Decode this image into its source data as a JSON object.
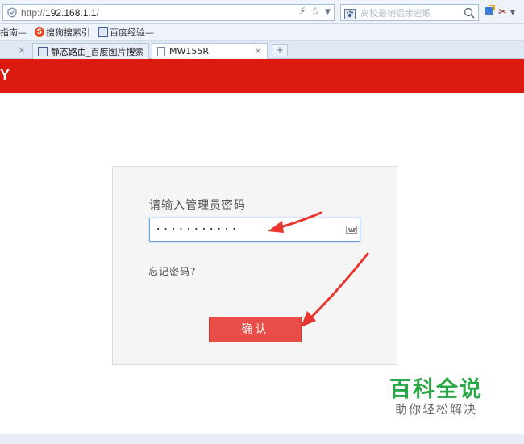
{
  "browser": {
    "url_prefix": "http://",
    "url_host": "192.168.1.1",
    "url_suffix": "/",
    "search_placeholder": "高校最销侣余密眼",
    "favorites": [
      {
        "label": "指南—"
      },
      {
        "label": "搜狗搜索引"
      },
      {
        "label": "百度经验—"
      }
    ],
    "tabs": [
      {
        "label": "静态路由_百度图片搜索",
        "active": false
      },
      {
        "label": "MW155R",
        "active": true
      }
    ],
    "new_tab_label": "+"
  },
  "page": {
    "brand_fragment": "Y",
    "login": {
      "prompt": "请输入管理员密码",
      "password_value": "···········",
      "forgot_link": "忘记密码?",
      "confirm_button": "确认"
    }
  },
  "watermark": {
    "title": "百科全说",
    "subtitle": "助你轻松解决"
  },
  "colors": {
    "brand_red": "#dc1a10",
    "button_red": "#e94d47",
    "annotation_red": "#e8372f",
    "watermark_green": "#28a745"
  }
}
